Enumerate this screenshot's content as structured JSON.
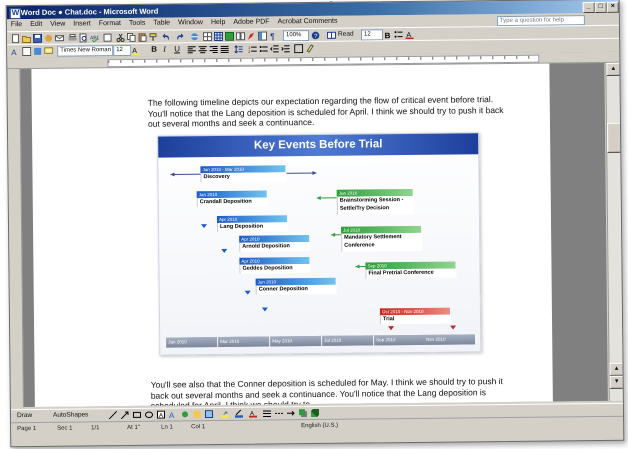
{
  "window": {
    "title": "Word Doc ● Chat.doc - Microsoft Word",
    "buttons": {
      "minimize": "_",
      "maximize": "□",
      "close": "×"
    }
  },
  "menu": {
    "items": [
      "File",
      "Edit",
      "View",
      "Insert",
      "Format",
      "Tools",
      "Table",
      "Window",
      "Help",
      "Adobe PDF",
      "Acrobat Comments"
    ],
    "help_placeholder": "Type a question for help"
  },
  "toolbar": {
    "zoom": "100%",
    "read_label": "Read",
    "style": "Times New Roman",
    "font_size": "12",
    "font_size_2": "12",
    "bold": "B",
    "italic": "I",
    "underline": "U"
  },
  "document": {
    "intro_paragraph": "The following timeline depicts our expectation regarding the flow of critical event before trial.  You'll notice that the Lang deposition is scheduled for April.  I think we should try to push it back out several months and seek a continuance.",
    "followup_paragraph": "You'll see also that the Conner deposition is scheduled for May.  I think we should try to push it back out several months and seek a continuance.  You'll notice that the Lang deposition is scheduled for April.  I think we should try to"
  },
  "slide": {
    "title": "Key Events Before Trial",
    "timeline_labels": [
      "Jan 2010",
      "Mar 2010",
      "May 2010",
      "Jul 2010",
      "Sep 2010",
      "Nov 2010"
    ],
    "events": [
      {
        "date": "Jan 2010 - Mar 2010",
        "label": "Discovery",
        "color": "#1e5bc6"
      },
      {
        "date": "Jan 2010",
        "label": "Crandall Deposition",
        "color": "#1e5bc6"
      },
      {
        "date": "Apr 2010",
        "label": "Lang Deposition",
        "color": "#1e5bc6"
      },
      {
        "date": "Apr 2010",
        "label": "Arnold Deposition",
        "color": "#1e5bc6"
      },
      {
        "date": "Apr 2010",
        "label": "Geddes Deposition",
        "color": "#1e5bc6"
      },
      {
        "date": "Jun 2010",
        "label": "Conner Deposition",
        "color": "#1e5bc6"
      },
      {
        "date": "Jun 2010",
        "label": "Brainstorming Session - Settle/Try Decision",
        "color": "#2e9e3a"
      },
      {
        "date": "Jul 2010",
        "label": "Mandatory Settlement Conference",
        "color": "#2e9e3a"
      },
      {
        "date": "Sep 2010",
        "label": "Final Pretrial Conference",
        "color": "#2e9e3a"
      },
      {
        "date": "Oct 2010 - Nov 2010",
        "label": "Trial",
        "color": "#c4281c"
      }
    ]
  },
  "drawing_toolbar": {
    "draw_label": "Draw",
    "autoshapes_label": "AutoShapes"
  },
  "statusbar": {
    "page": "Page 1",
    "sec": "Sec 1",
    "page_of": "1/1",
    "at": "At 1\"",
    "ln": "Ln 1",
    "col": "Col 1",
    "lang": "English (U.S.)"
  },
  "colors": {
    "titlebar": "#0a246a",
    "slide_title": "#1c3f9a",
    "blue_event": "#1e5bc6",
    "green_event": "#2e9e3a",
    "red_event": "#c4281c"
  }
}
